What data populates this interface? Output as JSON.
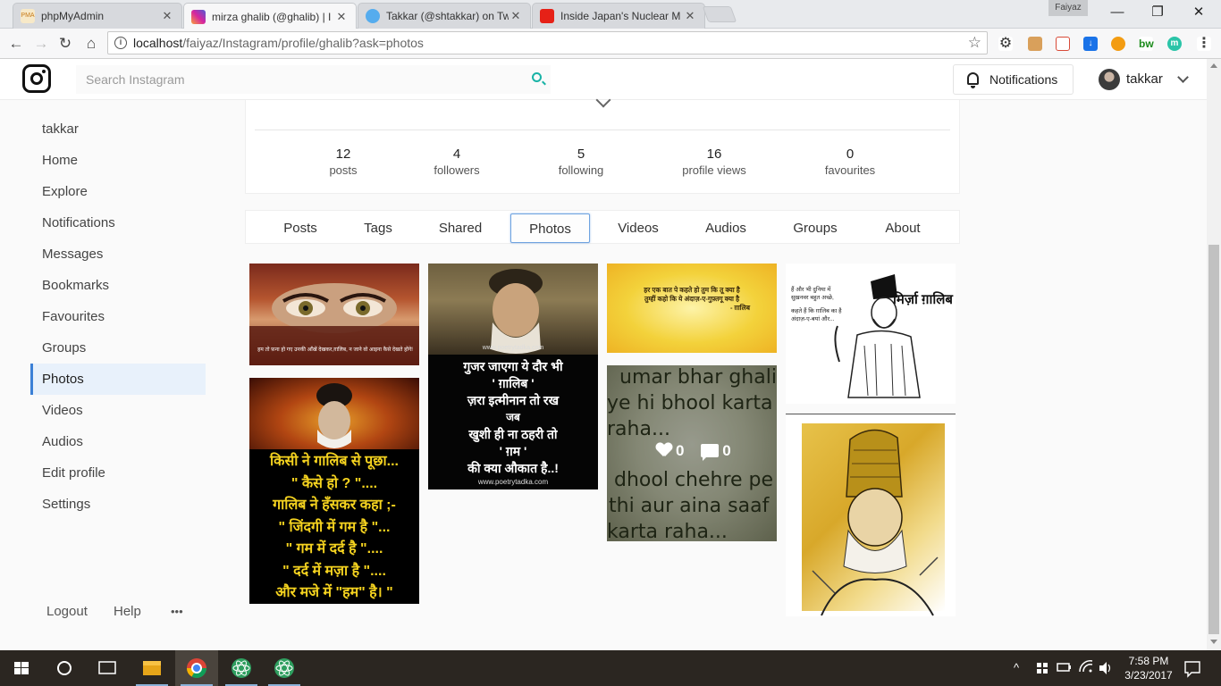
{
  "browser": {
    "tabs": [
      {
        "label": "phpMyAdmin",
        "icon": "phpmyadmin-icon"
      },
      {
        "label": "mirza ghalib (@ghalib) | I",
        "icon": "instagram-icon"
      },
      {
        "label": "Takkar (@shtakkar) on Tw",
        "icon": "twitter-icon"
      },
      {
        "label": "Inside Japan's Nuclear M",
        "icon": "youtube-icon"
      }
    ],
    "profile_name": "Faiyaz",
    "url_host": "localhost",
    "url_path": "/faiyaz/Instagram/profile/ghalib?ask=photos"
  },
  "header": {
    "search_placeholder": "Search Instagram",
    "notifications_label": "Notifications",
    "username": "takkar"
  },
  "sidebar": {
    "items": [
      {
        "label": "takkar"
      },
      {
        "label": "Home"
      },
      {
        "label": "Explore"
      },
      {
        "label": "Notifications"
      },
      {
        "label": "Messages"
      },
      {
        "label": "Bookmarks"
      },
      {
        "label": "Favourites"
      },
      {
        "label": "Groups"
      },
      {
        "label": "Photos",
        "active": true
      },
      {
        "label": "Videos"
      },
      {
        "label": "Audios"
      },
      {
        "label": "Edit profile"
      },
      {
        "label": "Settings"
      }
    ],
    "footer": {
      "logout": "Logout",
      "help": "Help",
      "more": "•••"
    }
  },
  "profile": {
    "stats": [
      {
        "value": "12",
        "label": "posts"
      },
      {
        "value": "4",
        "label": "followers"
      },
      {
        "value": "5",
        "label": "following"
      },
      {
        "value": "16",
        "label": "profile views"
      },
      {
        "value": "0",
        "label": "favourites"
      }
    ],
    "tabs": [
      "Posts",
      "Tags",
      "Shared",
      "Photos",
      "Videos",
      "Audios",
      "Groups",
      "About"
    ],
    "active_tab": "Photos"
  },
  "photos": {
    "p1": {
      "caption": "हम तो फ़ना हो गए उनकी आँखें देखकर,ग़ालिब, न जाने वो आइना कैसे देखते होंगे!"
    },
    "p2": {
      "site": "www.poetrytadka.com",
      "lines": [
        "गुजर जाएगा ये दौर भी",
        "' ग़ालिब '",
        "ज़रा इत्मीनान तो रख",
        "जब",
        "खुशी ही ना ठहरी तो",
        "' ग़म '",
        "की क्या औकात है..!"
      ],
      "footer": "www.poetrytadka.com"
    },
    "p3": {
      "lines": [
        "हर एक बात पे कहते हो तुम कि तू क्या है",
        "तुम्हीं कहो कि ये अंदाज़-ए-गुफ़्तगू क्या है",
        "- ग़ालिब"
      ]
    },
    "p4": {
      "lines": [
        "हैं और भी दुनिया में",
        "सुख़नवर बहुत अच्छे,",
        "कहते हैं कि ग़ालिब का है",
        "अंदाज़-ए-बयां और..."
      ],
      "title": "मिर्ज़ा ग़ालिब"
    },
    "p5": {
      "lines": [
        "किसी ने गालिब से पूछा...",
        "\" कैसे हो ? \"....",
        "गालिब ने हँसकर कहा ;-",
        "\" जिंदगी में गम है \"...",
        "\" गम में दर्द है \"....",
        "\" दर्द में मज़ा है \"....",
        "और मजे में \"हम\" है। \""
      ]
    },
    "p6": {
      "lines": [
        "umar bhar ghalib",
        "ye hi bhool karta",
        "raha...",
        "dhool chehre pe",
        "thi aur aina saaf",
        "karta raha..."
      ],
      "likes": "0",
      "comments": "0"
    }
  },
  "taskbar": {
    "time": "7:58 PM",
    "date": "3/23/2017"
  }
}
